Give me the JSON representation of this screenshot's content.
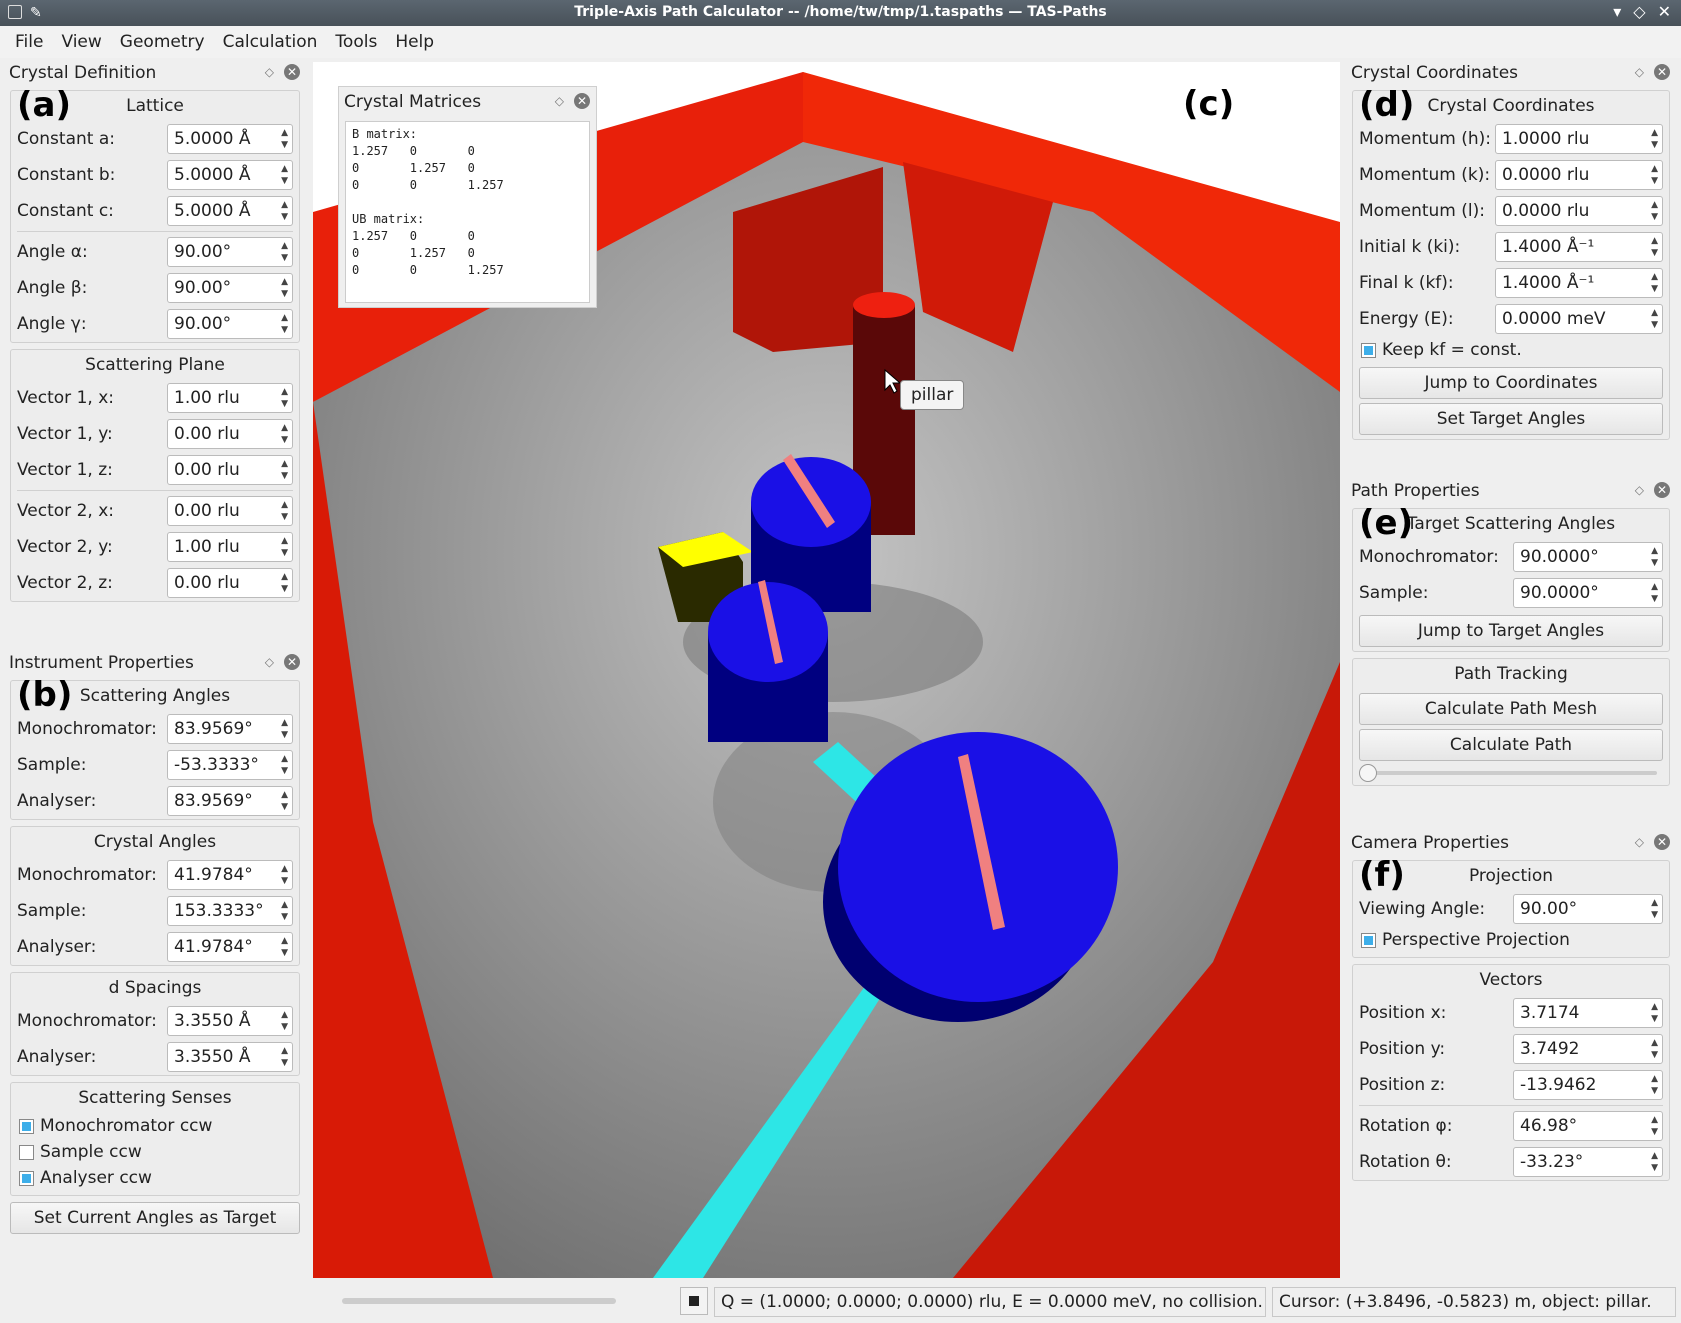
{
  "window": {
    "title": "Triple-Axis Path Calculator -- /home/tw/tmp/1.taspaths — TAS-Paths"
  },
  "menu": [
    "File",
    "View",
    "Geometry",
    "Calculation",
    "Tools",
    "Help"
  ],
  "crystal_definition": {
    "title": "Crystal Definition",
    "tag": "(a)",
    "lattice_title": "Lattice",
    "lattice": [
      {
        "label": "Constant a:",
        "value": "5.0000 Å"
      },
      {
        "label": "Constant b:",
        "value": "5.0000 Å"
      },
      {
        "label": "Constant c:",
        "value": "5.0000 Å"
      }
    ],
    "angles": [
      {
        "label": "Angle α:",
        "value": "90.00°"
      },
      {
        "label": "Angle β:",
        "value": "90.00°"
      },
      {
        "label": "Angle γ:",
        "value": "90.00°"
      }
    ],
    "plane_title": "Scattering Plane",
    "vec1": [
      {
        "label": "Vector 1, x:",
        "value": "1.00 rlu"
      },
      {
        "label": "Vector 1, y:",
        "value": "0.00 rlu"
      },
      {
        "label": "Vector 1, z:",
        "value": "0.00 rlu"
      }
    ],
    "vec2": [
      {
        "label": "Vector 2, x:",
        "value": "0.00 rlu"
      },
      {
        "label": "Vector 2, y:",
        "value": "1.00 rlu"
      },
      {
        "label": "Vector 2, z:",
        "value": "0.00 rlu"
      }
    ]
  },
  "instrument": {
    "title": "Instrument Properties",
    "tag": "(b)",
    "scat_title": "Scattering Angles",
    "scat": [
      {
        "label": "Monochromator:",
        "value": "83.9569°"
      },
      {
        "label": "Sample:",
        "value": "-53.3333°"
      },
      {
        "label": "Analyser:",
        "value": "83.9569°"
      }
    ],
    "cryst_title": "Crystal Angles",
    "cryst": [
      {
        "label": "Monochromator:",
        "value": "41.9784°"
      },
      {
        "label": "Sample:",
        "value": "153.3333°"
      },
      {
        "label": "Analyser:",
        "value": "41.9784°"
      }
    ],
    "d_title": "d Spacings",
    "d": [
      {
        "label": "Monochromator:",
        "value": "3.3550 Å"
      },
      {
        "label": "Analyser:",
        "value": "3.3550 Å"
      }
    ],
    "senses_title": "Scattering Senses",
    "senses": [
      "Monochromator ccw",
      "Sample ccw",
      "Analyser ccw"
    ],
    "set_target": "Set Current Angles as Target"
  },
  "matrices": {
    "title": "Crystal Matrices",
    "text": "B matrix:\n1.257   0       0\n0       1.257   0\n0       0       1.257\n\nUB matrix:\n1.257   0       0\n0       1.257   0\n0       0       1.257"
  },
  "view": {
    "tag": "(c)",
    "tooltip": "pillar"
  },
  "coords": {
    "title": "Crystal Coordinates",
    "tag": "(d)",
    "group_title": "Crystal Coordinates",
    "rows": [
      {
        "label": "Momentum (h):",
        "value": "1.0000 rlu"
      },
      {
        "label": "Momentum (k):",
        "value": "0.0000 rlu"
      },
      {
        "label": "Momentum (l):",
        "value": "0.0000 rlu"
      },
      {
        "label": "Initial k (ki):",
        "value": "1.4000 Å⁻¹"
      },
      {
        "label": "Final k (kf):",
        "value": "1.4000 Å⁻¹"
      },
      {
        "label": "Energy (E):",
        "value": "0.0000 meV"
      }
    ],
    "keep_kf": "Keep kf = const.",
    "jump": "Jump to Coordinates",
    "set_target": "Set Target Angles"
  },
  "path": {
    "title": "Path Properties",
    "tag": "(e)",
    "target_title": "Target Scattering Angles",
    "rows": [
      {
        "label": "Monochromator:",
        "value": "90.0000°"
      },
      {
        "label": "Sample:",
        "value": "90.0000°"
      }
    ],
    "jump": "Jump to Target Angles",
    "tracking_title": "Path Tracking",
    "calc_mesh": "Calculate Path Mesh",
    "calc_path": "Calculate Path",
    "slider_value": 0
  },
  "camera": {
    "title": "Camera Properties",
    "tag": "(f)",
    "proj_title": "Projection",
    "viewing": {
      "label": "Viewing Angle:",
      "value": "90.00°"
    },
    "perspective": "Perspective Projection",
    "vec_title": "Vectors",
    "rows": [
      {
        "label": "Position x:",
        "value": "3.7174"
      },
      {
        "label": "Position y:",
        "value": "3.7492"
      },
      {
        "label": "Position z:",
        "value": "-13.9462"
      }
    ],
    "rot": [
      {
        "label": "Rotation φ:",
        "value": "46.98°"
      },
      {
        "label": "Rotation θ:",
        "value": "-33.23°"
      }
    ]
  },
  "status": {
    "q": "Q = (1.0000; 0.0000; 0.0000) rlu, E = 0.0000 meV, no collision.",
    "cursor": "Cursor: (+3.8496, -0.5823) m, object: pillar."
  },
  "colors": {
    "wall": "#e8200a",
    "floor": "#9a9a9a",
    "axis": "#1a10e6",
    "beam": "#2de6e6"
  }
}
